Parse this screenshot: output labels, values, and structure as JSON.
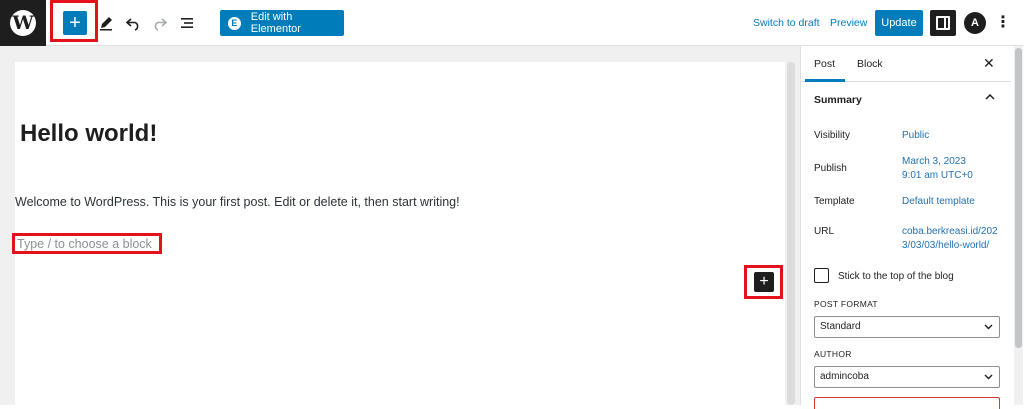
{
  "toolbar": {
    "logo_letter": "W",
    "add_icon": "+",
    "edit_with_elementor": "Edit with Elementor",
    "elementor_icon": "E",
    "switch_to_draft": "Switch to draft",
    "preview": "Preview",
    "update": "Update",
    "astra_icon": "A",
    "more_icon": "⋮"
  },
  "editor": {
    "title": "Hello world!",
    "paragraph": "Welcome to WordPress. This is your first post. Edit or delete it, then start writing!",
    "placeholder": "Type / to choose a block",
    "inserter_icon": "+"
  },
  "sidebar": {
    "tabs": [
      "Post",
      "Block"
    ],
    "close_icon": "✕",
    "section_title": "Summary",
    "visibility_label": "Visibility",
    "visibility_value": "Public",
    "publish_label": "Publish",
    "publish_date": "March 3, 2023",
    "publish_time": "9:01 am UTC+0",
    "template_label": "Template",
    "template_value": "Default template",
    "url_label": "URL",
    "url_line1": "coba.berkreasi.id/202",
    "url_line2": "3/03/03/hello-world/",
    "sticky_label": "Stick to the top of the blog",
    "post_format_label": "POST FORMAT",
    "post_format_value": "Standard",
    "author_label": "AUTHOR",
    "author_value": "admincoba"
  },
  "colors": {
    "accent": "#007cba",
    "highlight": "#e3111b",
    "dark": "#1e1e1e"
  }
}
